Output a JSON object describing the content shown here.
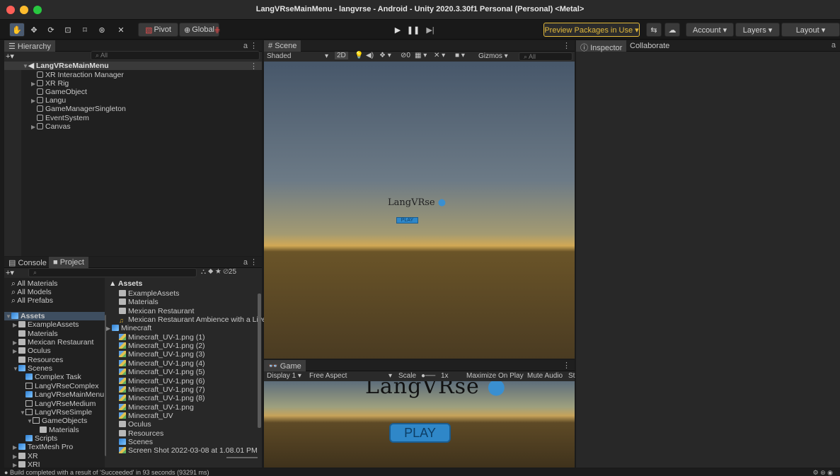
{
  "window": {
    "title": "LangVRseMainMenu - langvrse - Android - Unity 2020.3.30f1 Personal (Personal) <Metal>"
  },
  "toolbar": {
    "pivot": "Pivot",
    "global": "Global",
    "preview_packages": "Preview Packages in Use ▾",
    "account": "Account ▾",
    "layers": "Layers ▾",
    "layout": "Layout ▾"
  },
  "hierarchy": {
    "tab": "Hierarchy",
    "search_placeholder": "All",
    "scene": "LangVRseMainMenu",
    "items": [
      {
        "label": "XR Interaction Manager",
        "expandable": false
      },
      {
        "label": "XR Rig",
        "expandable": true
      },
      {
        "label": "GameObject",
        "expandable": false
      },
      {
        "label": "Langu",
        "expandable": true
      },
      {
        "label": "GameManagerSingleton",
        "expandable": false
      },
      {
        "label": "EventSystem",
        "expandable": false
      },
      {
        "label": "Canvas",
        "expandable": true
      }
    ]
  },
  "bottom_left": {
    "tab_console": "Console",
    "tab_project": "Project",
    "hidden_count": "25",
    "favorites": [
      "All Materials",
      "All Models",
      "All Prefabs"
    ],
    "tree": [
      {
        "label": "Assets",
        "level": 0,
        "type": "folder-blue",
        "expanded": true,
        "selected": true
      },
      {
        "label": "ExampleAssets",
        "level": 1,
        "type": "folder",
        "arrow": true
      },
      {
        "label": "Materials",
        "level": 1,
        "type": "folder"
      },
      {
        "label": "Mexican Restaurant",
        "level": 1,
        "type": "folder",
        "arrow": true
      },
      {
        "label": "Oculus",
        "level": 1,
        "type": "folder",
        "arrow": true
      },
      {
        "label": "Resources",
        "level": 1,
        "type": "folder"
      },
      {
        "label": "Scenes",
        "level": 1,
        "type": "folder-blue",
        "expanded": true
      },
      {
        "label": "Complex Task",
        "level": 2,
        "type": "scene"
      },
      {
        "label": "LangVRseComplex",
        "level": 2,
        "type": "folder-outline"
      },
      {
        "label": "LangVRseMainMenu",
        "level": 2,
        "type": "scene"
      },
      {
        "label": "LangVRseMedium",
        "level": 2,
        "type": "folder-outline"
      },
      {
        "label": "LangVRseSimple",
        "level": 2,
        "type": "folder-outline",
        "expanded": true
      },
      {
        "label": "GameObjects",
        "level": 3,
        "type": "folder-outline",
        "expanded": true
      },
      {
        "label": "Materials",
        "level": 4,
        "type": "folder"
      },
      {
        "label": "Scripts",
        "level": 2,
        "type": "scene"
      },
      {
        "label": "TextMesh Pro",
        "level": 1,
        "type": "folder-blue",
        "arrow": true
      },
      {
        "label": "XR",
        "level": 1,
        "type": "folder",
        "arrow": true
      },
      {
        "label": "XRI",
        "level": 1,
        "type": "folder",
        "arrow": true
      }
    ],
    "assets_header": "Assets",
    "assets": [
      {
        "label": "ExampleAssets",
        "type": "folder"
      },
      {
        "label": "Materials",
        "type": "folder"
      },
      {
        "label": "Mexican Restaurant",
        "type": "folder"
      },
      {
        "label": "Mexican Restaurant Ambience with a Live",
        "type": "audio"
      },
      {
        "label": "Minecraft",
        "type": "model"
      },
      {
        "label": "Minecraft_UV-1.png (1)",
        "type": "image"
      },
      {
        "label": "Minecraft_UV-1.png (2)",
        "type": "image"
      },
      {
        "label": "Minecraft_UV-1.png (3)",
        "type": "image"
      },
      {
        "label": "Minecraft_UV-1.png (4)",
        "type": "image"
      },
      {
        "label": "Minecraft_UV-1.png (5)",
        "type": "image"
      },
      {
        "label": "Minecraft_UV-1.png (6)",
        "type": "image"
      },
      {
        "label": "Minecraft_UV-1.png (7)",
        "type": "image"
      },
      {
        "label": "Minecraft_UV-1.png (8)",
        "type": "image"
      },
      {
        "label": "Minecraft_UV-1.png",
        "type": "image"
      },
      {
        "label": "Minecraft_UV",
        "type": "image"
      },
      {
        "label": "Oculus",
        "type": "folder"
      },
      {
        "label": "Resources",
        "type": "folder"
      },
      {
        "label": "Scenes",
        "type": "folder-blue"
      },
      {
        "label": "Screen Shot 2022-03-08 at 1.08.01 PM",
        "type": "image-strip"
      }
    ]
  },
  "scene": {
    "tab": "Scene",
    "shading": "Shaded",
    "mode_2d": "2D",
    "fx_count": "0",
    "gizmos": "Gizmos ▾",
    "search_placeholder": "All",
    "logo": "LangVRse",
    "play": "PLAY"
  },
  "game": {
    "tab": "Game",
    "display": "Display 1 ▾",
    "aspect": "Free Aspect",
    "scale_label": "Scale",
    "scale_value": "1x",
    "maximize": "Maximize On Play",
    "mute": "Mute Audio",
    "stats": "St",
    "logo": "LangVRse",
    "play": "PLAY"
  },
  "inspector": {
    "tab": "Inspector",
    "tab_collab": "Collaborate"
  },
  "status": {
    "message": "Build completed with a result of 'Succeeded' in 93 seconds (93291 ms)"
  },
  "colors": {
    "accent_yellow": "#e2b93b",
    "selection_blue": "#2c5d87",
    "panel_bg": "#282828"
  }
}
